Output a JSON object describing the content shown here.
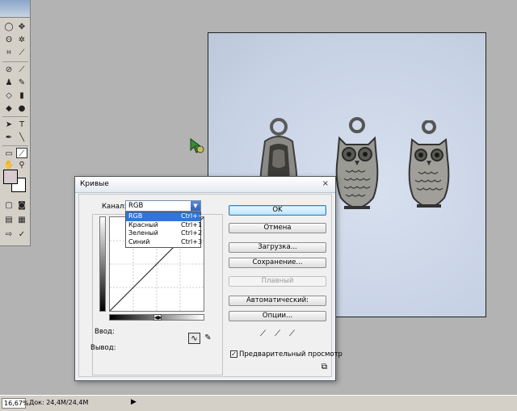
{
  "dialog": {
    "title": "Кривые",
    "close": "×",
    "channel_label": "Канал:",
    "channel_value": "RGB",
    "channel_options": [
      {
        "name": "RGB",
        "shortcut": "Ctrl+~"
      },
      {
        "name": "Красный",
        "shortcut": "Ctrl+1"
      },
      {
        "name": "Зеленый",
        "shortcut": "Ctrl+2"
      },
      {
        "name": "Синий",
        "shortcut": "Ctrl+3"
      }
    ],
    "input_label": "Ввод:",
    "output_label": "Вывод:",
    "buttons": {
      "ok": "OK",
      "cancel": "Отмена",
      "load": "Загрузка...",
      "save": "Сохранение...",
      "smooth": "Плавный",
      "auto": "Автоматический:",
      "options": "Опции..."
    },
    "preview_label": "Предварительный просмотр",
    "preview_checked": true
  },
  "statusbar": {
    "zoom": "16,67%",
    "doc": "Док: 24,4M/24,4M"
  },
  "colors": {
    "workspace": "#b3b3b3",
    "canvas": "#c9d4e6",
    "selected_item": "#3275d6"
  }
}
